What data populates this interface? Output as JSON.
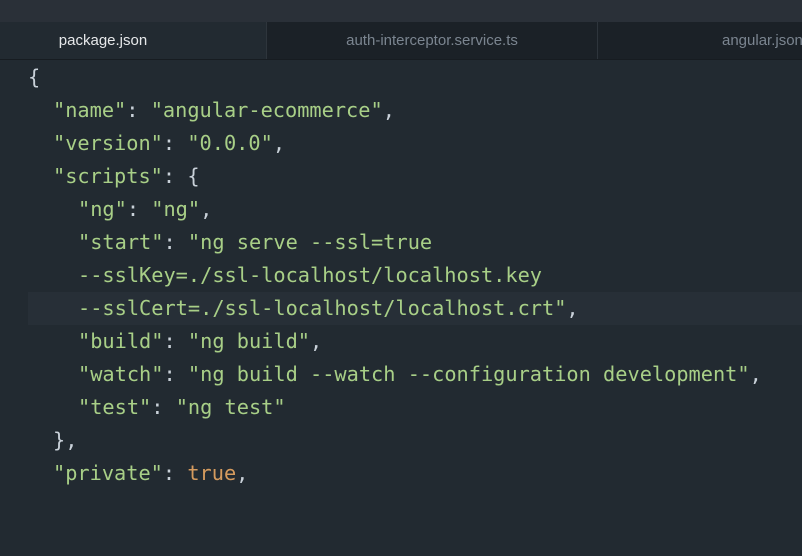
{
  "tabs": [
    {
      "label": "package.json",
      "active": true
    },
    {
      "label": "auth-interceptor.service.ts",
      "active": false
    },
    {
      "label": "angular.json",
      "active": false
    }
  ],
  "colors": {
    "background": "#222a31",
    "tab_bar": "#1b2127",
    "string": "#a8cf87",
    "punctuation": "#c9d1d9",
    "boolean": "#d59b5e",
    "current_line": "#272f37"
  },
  "code": {
    "l1": {
      "open": "{"
    },
    "l2": {
      "key": "\"name\"",
      "sep": ": ",
      "value": "\"angular-ecommerce\"",
      "end": ","
    },
    "l3": {
      "key": "\"version\"",
      "sep": ": ",
      "value": "\"0.0.0\"",
      "end": ","
    },
    "l4": {
      "key": "\"scripts\"",
      "sep": ": {"
    },
    "l5": {
      "key": "\"ng\"",
      "sep": ": ",
      "value": "\"ng\"",
      "end": ","
    },
    "l6": {
      "key": "\"start\"",
      "sep": ": ",
      "value": "\"ng serve --ssl=true"
    },
    "l7": {
      "value": "--sslKey=./ssl-localhost/localhost.key"
    },
    "l8": {
      "value": "--sslCert=./ssl-localhost/localhost.crt\"",
      "end": ","
    },
    "l9": {
      "key": "\"build\"",
      "sep": ": ",
      "value": "\"ng build\"",
      "end": ","
    },
    "l10": {
      "key": "\"watch\"",
      "sep": ": ",
      "value": "\"ng build --watch --configuration development\"",
      "end": ","
    },
    "l11": {
      "key": "\"test\"",
      "sep": ": ",
      "value": "\"ng test\""
    },
    "l12": {
      "close": "},"
    },
    "l13": {
      "key": "\"private\"",
      "sep": ": ",
      "value": "true",
      "end": ","
    }
  }
}
